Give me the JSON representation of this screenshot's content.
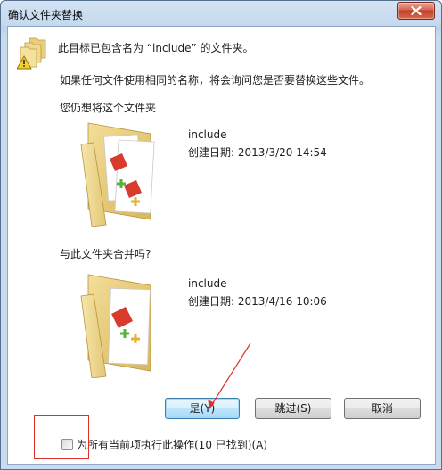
{
  "window": {
    "title": "确认文件夹替换"
  },
  "message": {
    "line1": "此目标已包含名为 “include” 的文件夹。",
    "line2": "如果任何文件使用相同的名称，将会询问您是否要替换这些文件。",
    "line3": "您仍想将这个文件夹",
    "merge_question": "与此文件夹合并吗?"
  },
  "existing_folder": {
    "name": "include",
    "created": "创建日期: 2013/3/20 14:54"
  },
  "source_folder": {
    "name": "include",
    "created": "创建日期: 2013/4/16 10:06"
  },
  "buttons": {
    "yes": "是(Y)",
    "skip": "跳过(S)",
    "cancel": "取消"
  },
  "apply_all": {
    "label": "为所有当前项执行此操作(10 已找到)(A)",
    "checked": false
  },
  "icons": {
    "close": "close-icon",
    "warning": "folder-warning-icon",
    "folder": "folder-icon"
  },
  "colors": {
    "annotation": "#e0302a",
    "accent": "#3c7fb1"
  }
}
